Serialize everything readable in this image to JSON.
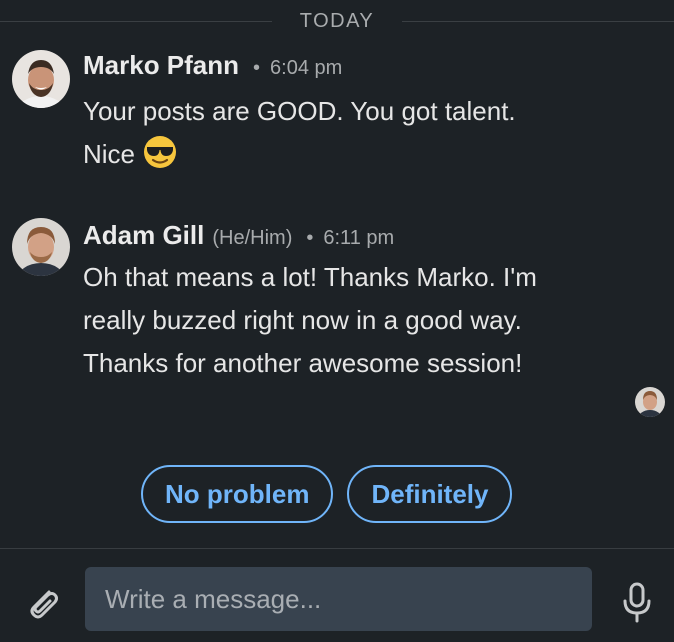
{
  "divider": {
    "label": "TODAY"
  },
  "messages": [
    {
      "sender": "Marko Pfann",
      "pronouns": "",
      "time": "6:04 pm",
      "text_line1": "Your posts are GOOD. You got talent.",
      "text_line2": "Nice",
      "emoji": "smiling-face-with-sunglasses"
    },
    {
      "sender": "Adam Gill",
      "pronouns": "(He/Him)",
      "time": "6:11 pm",
      "text_lines": [
        "Oh that means a lot! Thanks Marko. I'm",
        "really buzzed right now in a good way.",
        "Thanks for another awesome session!"
      ]
    }
  ],
  "separator_dot": "•",
  "smart_replies": [
    "No problem",
    "Definitely"
  ],
  "composer": {
    "placeholder": "Write a message...",
    "attach_icon": "paperclip-icon",
    "mic_icon": "microphone-icon"
  },
  "colors": {
    "background": "#1d2226",
    "accent": "#70b5f9",
    "input_background": "#38434f"
  }
}
